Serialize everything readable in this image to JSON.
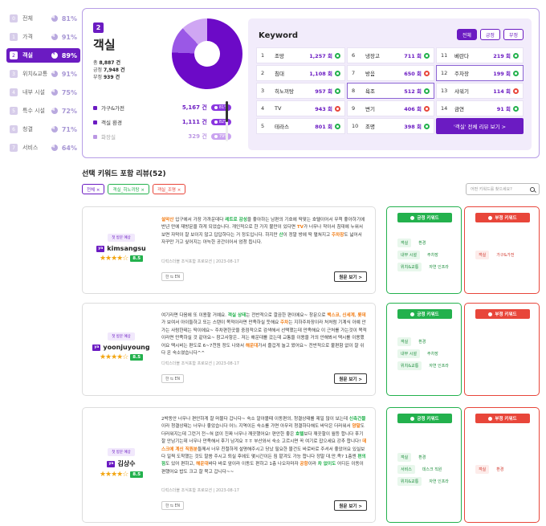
{
  "sidebar": {
    "items": [
      {
        "num": "0",
        "name": "전체",
        "pct": "81%"
      },
      {
        "num": "1",
        "name": "가격",
        "pct": "91%"
      },
      {
        "num": "2",
        "name": "객실",
        "pct": "89%",
        "active": true
      },
      {
        "num": "3",
        "name": "위치&교통",
        "pct": "91%"
      },
      {
        "num": "4",
        "name": "내부 시설",
        "pct": "75%"
      },
      {
        "num": "5",
        "name": "특수 시설",
        "pct": "72%"
      },
      {
        "num": "6",
        "name": "청결",
        "pct": "71%"
      },
      {
        "num": "7",
        "name": "서비스",
        "pct": "64%"
      }
    ]
  },
  "summary": {
    "num": "2",
    "title": "객실",
    "stats": [
      {
        "label": "총",
        "value": "8,887 건"
      },
      {
        "label": "긍정",
        "value": "7,948 건"
      },
      {
        "label": "부정",
        "value": "939 건"
      }
    ],
    "donut_shares": [
      0.755,
      0.123,
      0.122
    ],
    "colors": {
      "accent": "#6b1bc2",
      "positive": "#23b14d",
      "negative": "#e8463a"
    },
    "legend": [
      {
        "name": "가구&가전",
        "count": "5,167 건",
        "pct": "81%"
      },
      {
        "name": "객실 환경",
        "count": "1,111 건",
        "pct": "82%"
      },
      {
        "name": "화장실",
        "count": "329 건",
        "pct": "79%"
      }
    ]
  },
  "keyword_panel": {
    "title": "Keyword",
    "filters": [
      "전체",
      "긍정",
      "부정"
    ],
    "items": [
      {
        "n": "1",
        "kw": "조망",
        "count": "1,257 회",
        "s": "pos"
      },
      {
        "n": "6",
        "kw": "냉장고",
        "count": "711 회",
        "s": "pos"
      },
      {
        "n": "11",
        "kw": "베란다",
        "count": "219 회",
        "s": "pos"
      },
      {
        "n": "2",
        "kw": "침대",
        "count": "1,108 회",
        "s": "pos"
      },
      {
        "n": "7",
        "kw": "방음",
        "count": "650 회",
        "s": "neg"
      },
      {
        "n": "12",
        "kw": "주차장",
        "count": "199 회",
        "s": "pos"
      },
      {
        "n": "3",
        "kw": "히노끼탕",
        "count": "957 회",
        "s": "pos"
      },
      {
        "n": "8",
        "kw": "욕조",
        "count": "512 회",
        "s": "pos"
      },
      {
        "n": "13",
        "kw": "샤워기",
        "count": "114 회",
        "s": "neg"
      },
      {
        "n": "4",
        "kw": "TV",
        "count": "943 회",
        "s": "neg"
      },
      {
        "n": "9",
        "kw": "변기",
        "count": "406 회",
        "s": "neg"
      },
      {
        "n": "14",
        "kw": "금연",
        "count": "91 회",
        "s": "pos"
      },
      {
        "n": "5",
        "kw": "테라스",
        "count": "801 회",
        "s": "pos"
      },
      {
        "n": "10",
        "kw": "조명",
        "count": "398 회",
        "s": "pos"
      }
    ],
    "all_button": "'객실' 전체 리뷰 보기 >"
  },
  "reviews": {
    "title": "선택 키워드 포함 리뷰(52)",
    "chips": [
      "전체 ×",
      "객실_히노끼탕 ×",
      "객실_조명 ×"
    ],
    "search_placeholder": "어떤 키워드를 찾으세요?",
    "items": [
      {
        "tag": "첫 방문 예상",
        "name": "kimsangsu",
        "stars": "★★★★☆",
        "score": "8.5",
        "segments": [
          {
            "t": "설악산",
            "c": "o"
          },
          {
            "t": " 입구에서 가장 가까운데다 "
          },
          {
            "t": "레트로 감성",
            "c": "g"
          },
          {
            "t": "을 좋아하는 남편의 기호에 딱맞는 호텔이어서 무척 좋아하기에 반년 만에 재방문을 하게 되었습니다. 개인적으로 한 가지 불만이 있다면 "
          },
          {
            "t": "TV",
            "c": "o"
          },
          {
            "t": "가 너무나 작아서 침대에 누워서 보면 자막이 잘 보이지 않고 답답하다는 거 정도입니다. 하지만 "
          },
          {
            "t": "산",
            "c": "g"
          },
          {
            "t": "이 정말 방에 딱 펼쳐지고 "
          },
          {
            "t": "주차장",
            "c": "o"
          },
          {
            "t": "도 넓어서 자꾸만 가고 싶어지는 아늑한 공간이어서 엄청 듭니다."
          }
        ],
        "meta": "디럭스더블 조식포함 프로모션  |  2023-08-17",
        "trans": "한 ⇆ EN",
        "btn": "원문 보기 >",
        "pos": [
          [
            "객실",
            "환경"
          ],
          [
            "내부 시설",
            "주차장"
          ],
          [
            "위치&교통",
            "자연 인프라"
          ]
        ],
        "neg": [
          [
            "객실",
            "가구&가전"
          ]
        ]
      },
      {
        "tag": "첫 방문 예상",
        "name": "yoonjuyoung",
        "stars": "★★★★☆",
        "score": "8.5",
        "segments": [
          {
            "t": "여기라면 다음에 또 이용할 거예요. "
          },
          {
            "t": "객실 상태",
            "c": "g"
          },
          {
            "t": "는 전반적으로 깔끔한 편이에요~ 창문으로 "
          },
          {
            "t": "백스코",
            "c": "o"
          },
          {
            "t": ", "
          },
          {
            "t": "신세계",
            "c": "o"
          },
          {
            "t": ", "
          },
          {
            "t": "롯데",
            "c": "o"
          },
          {
            "t": "가 보여서 아이들하고 또는 스탠이 목적이라면 만족하실 듯해요 "
          },
          {
            "t": "주차",
            "c": "o"
          },
          {
            "t": "는 지하주차장이라 처처럼 기계식 아예 안가는 사람한테는 딱이에요~ 주차편한곳을 중점적으로 검색해서 선택했는데 만족해요 이 근처를 가는것이 목적이라면 만족하실 것 같아요~ 참고사항은.. 저는 해운대를 갔는데 교통을 이용을 거의 안해봐서 택시를 이용했어요 택시비는 편도로 6~7천원 정도 나와서 "
          },
          {
            "t": "해운대",
            "c": "o"
          },
          {
            "t": "가서 즐겁게 놀고 왔어요~ 전반적으로 불편함 없이 잘 쉬다 온 숙소였습니다^^"
          }
        ],
        "meta": "디럭스더블 조식포함 프로모션  |  2023-08-17",
        "trans": "한 ⇆ EN",
        "btn": "원문 보기 >",
        "pos": [
          [
            "객실",
            "환경"
          ],
          [
            "내부 시설",
            "주차장"
          ],
          [
            "위치&교통",
            "자연 인프라"
          ]
        ],
        "neg": []
      },
      {
        "tag": "첫 방문 예상",
        "name": "김상수",
        "stars": "★★★★☆",
        "score": "8.5",
        "segments": [
          {
            "t": "2박동안 너무나 편안하게 잘 머물다 갑니다~ 숙소 알아볼때 이동편의, 청결상태를 제일 많이 보는데 "
          },
          {
            "t": "신축건물",
            "c": "g"
          },
          {
            "t": "이라 청결상태는 너무나 좋았습니다 어느 지역이든 숙소를 가면 아무리 청결하다해도 바닥은 더러워서 "
          },
          {
            "t": "양말",
            "c": "o"
          },
          {
            "t": "도 더러워지는데 그런거 전~혀 없이 진짜 너무나 깨끗했어요! 편안한 좋은 "
          },
          {
            "t": "호텔",
            "c": "g"
          },
          {
            "t": "보다 깨끗할이 월등 합니다 후기 잘 안남기는데 너무나 만족해서 후기 남겨요 ㅎㅎ 부산와서 숙소 고르시면 꼭 여기로 잡으세요 강추 합니다! "
          },
          {
            "t": "데스크에 계신 직원분",
            "c": "o"
          },
          {
            "t": "들께서 너무 친절하게 설명해주시고 당났 필요한 물건도 바로바로 주셔서 좋았어요 있실보다 일찍 도착했는 것도 말씀 주시고 퇴실 후에도 몇시간이든 짐 맡겨도 가능 합니다 정말 대.만.족? 1층엔 "
          },
          {
            "t": "편의점",
            "c": "g"
          },
          {
            "t": "도 있어 편하고, "
          },
          {
            "t": "해운대",
            "c": "o"
          },
          {
            "t": "바다 바로 앞이라 이동도 편하고 1층 나오자마자 "
          },
          {
            "t": "공항",
            "c": "o"
          },
          {
            "t": "이라 "
          },
          {
            "t": "차 없이도",
            "c": "g"
          },
          {
            "t": " 어디든 이동이 편했어요 밥도 크고 잘 묵고 갑니다~~"
          }
        ],
        "meta": "디럭스더블 조식포함 프로모션  |  2023-08-17",
        "trans": "한 ⇆ EN",
        "btn": "원문 보기 >",
        "pos": [
          [
            "객실",
            "환경"
          ],
          [
            "서비스",
            "데스크 직원"
          ],
          [
            "위치&교통",
            "자연 인프라"
          ]
        ],
        "neg": [
          [
            "객실",
            "환경"
          ]
        ]
      }
    ],
    "pos_head": "긍정 키워드",
    "neg_head": "부정 키워드"
  }
}
